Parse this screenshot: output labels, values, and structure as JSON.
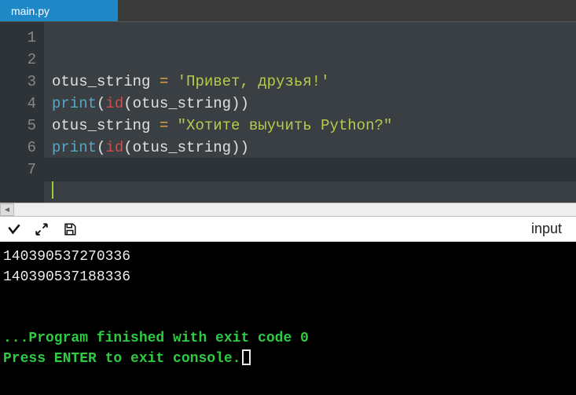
{
  "tab": {
    "name": "main.py"
  },
  "gutter": [
    "1",
    "2",
    "3",
    "4",
    "5",
    "6",
    "7"
  ],
  "code": {
    "l2": {
      "var": "otus_string",
      "op": " = ",
      "str": "'Привет, друзья!'"
    },
    "l3": {
      "fn": "print",
      "p1": "(",
      "bi": "id",
      "p2": "(",
      "var": "otus_string",
      "p3": "))"
    },
    "l4": {
      "var": "otus_string",
      "op": " = ",
      "str": "\"Хотите выучить Python?\""
    },
    "l5": {
      "fn": "print",
      "p1": "(",
      "bi": "id",
      "p2": "(",
      "var": "otus_string",
      "p3": "))"
    }
  },
  "toolbar": {
    "input_label": "input"
  },
  "console": {
    "out1": "140390537270336",
    "out2": "140390537188336",
    "blank": "",
    "blank2": "",
    "finished": "...Program finished with exit code 0",
    "prompt": "Press ENTER to exit console."
  }
}
